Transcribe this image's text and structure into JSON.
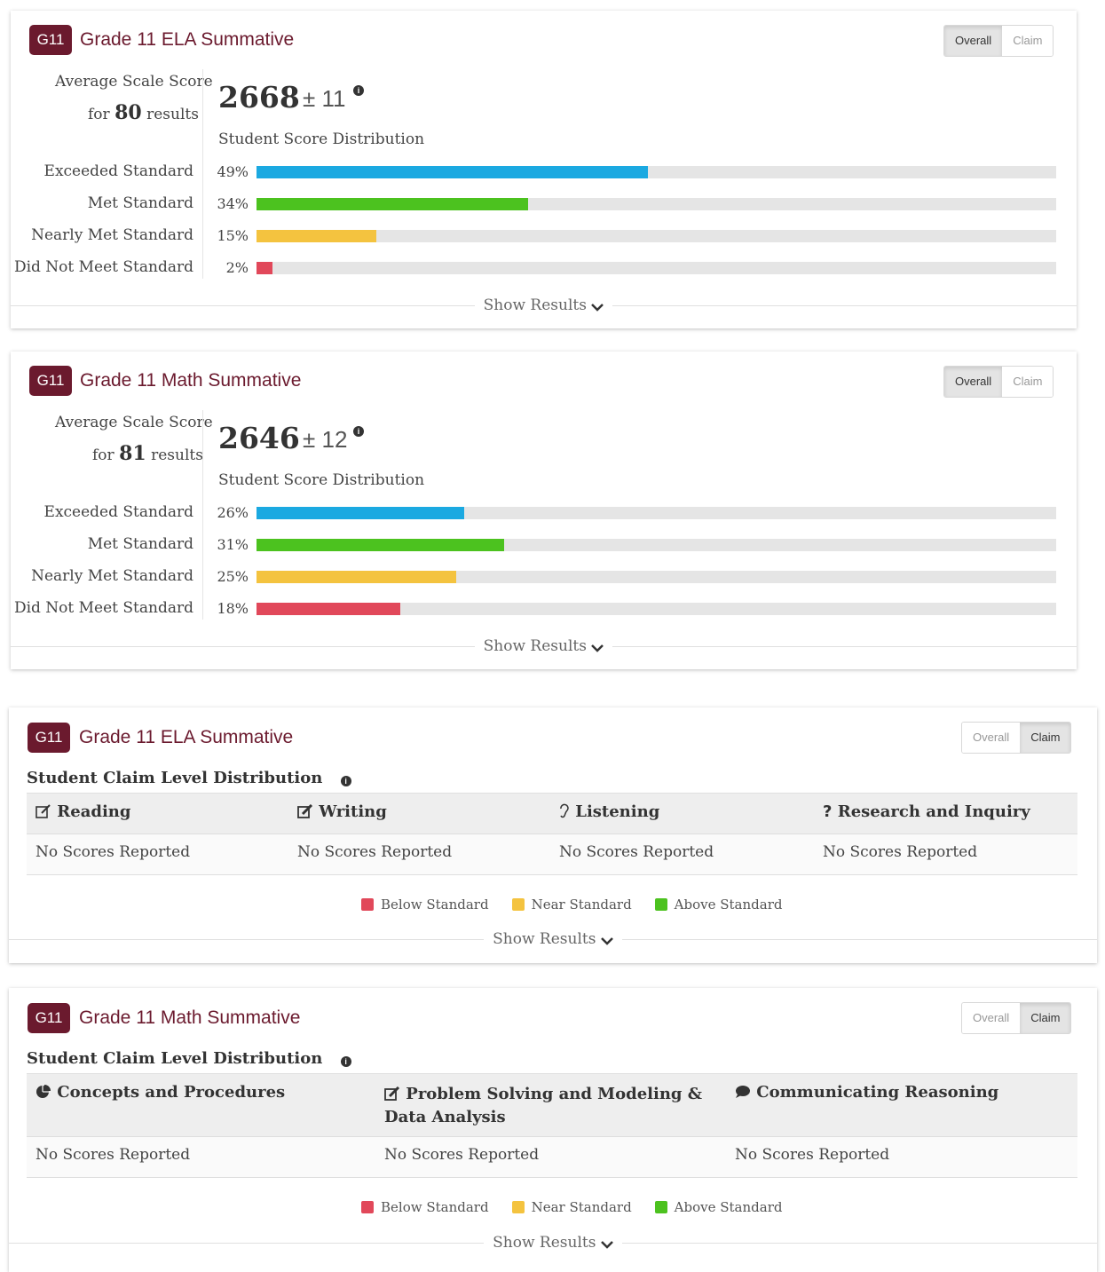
{
  "colors": {
    "badge": "#6b1a2e",
    "exceeded": "#1ba9e1",
    "met": "#4cc21f",
    "nearly": "#f4c33f",
    "not_met": "#e1485a",
    "track": "#e5e5e5"
  },
  "cards_overall": [
    {
      "badge": "G11",
      "title": "Grade 11 ELA Summative",
      "toggle": {
        "overall": "Overall",
        "claim": "Claim",
        "active": "overall"
      },
      "avg_label": "Average Scale Score",
      "for_text": "for",
      "count": "80",
      "results_text": "results",
      "score": "2668",
      "pm": "± 11",
      "dist_title": "Student Score Distribution",
      "rows": [
        {
          "label": "Exceeded Standard",
          "pct_text": "49%",
          "value": 49,
          "color_key": "exceeded"
        },
        {
          "label": "Met Standard",
          "pct_text": "34%",
          "value": 34,
          "color_key": "met"
        },
        {
          "label": "Nearly Met Standard",
          "pct_text": "15%",
          "value": 15,
          "color_key": "nearly"
        },
        {
          "label": "Did Not Meet Standard",
          "pct_text": "2%",
          "value": 2,
          "color_key": "not_met"
        }
      ],
      "show_results": "Show Results"
    },
    {
      "badge": "G11",
      "title": "Grade 11 Math Summative",
      "toggle": {
        "overall": "Overall",
        "claim": "Claim",
        "active": "overall"
      },
      "avg_label": "Average Scale Score",
      "for_text": "for",
      "count": "81",
      "results_text": "results",
      "score": "2646",
      "pm": "± 12",
      "dist_title": "Student Score Distribution",
      "rows": [
        {
          "label": "Exceeded Standard",
          "pct_text": "26%",
          "value": 26,
          "color_key": "exceeded"
        },
        {
          "label": "Met Standard",
          "pct_text": "31%",
          "value": 31,
          "color_key": "met"
        },
        {
          "label": "Nearly Met Standard",
          "pct_text": "25%",
          "value": 25,
          "color_key": "nearly"
        },
        {
          "label": "Did Not Meet Standard",
          "pct_text": "18%",
          "value": 18,
          "color_key": "not_met"
        }
      ],
      "show_results": "Show Results"
    }
  ],
  "cards_claim": [
    {
      "badge": "G11",
      "title": "Grade 11 ELA Summative",
      "toggle": {
        "overall": "Overall",
        "claim": "Claim",
        "active": "claim"
      },
      "heading": "Student Claim Level Distribution",
      "columns": [
        {
          "icon": "edit-icon",
          "label": "Reading",
          "value": "No Scores Reported"
        },
        {
          "icon": "pencil-square-icon",
          "label": "Writing",
          "value": "No Scores Reported"
        },
        {
          "icon": "ear-icon",
          "label": "Listening",
          "value": "No Scores Reported"
        },
        {
          "icon": "question-icon",
          "label": "Research and Inquiry",
          "value": "No Scores Reported"
        }
      ],
      "legend": [
        "Below Standard",
        "Near Standard",
        "Above Standard"
      ],
      "show_results": "Show Results"
    },
    {
      "badge": "G11",
      "title": "Grade 11 Math Summative",
      "toggle": {
        "overall": "Overall",
        "claim": "Claim",
        "active": "claim"
      },
      "heading": "Student Claim Level Distribution",
      "columns": [
        {
          "icon": "pie-chart-icon",
          "label": "Concepts and Procedures",
          "value": "No Scores Reported"
        },
        {
          "icon": "pencil-square-icon",
          "label": "Problem Solving and Modeling & Data Analysis",
          "value": "No Scores Reported"
        },
        {
          "icon": "comment-icon",
          "label": "Communicating Reasoning",
          "value": "No Scores Reported"
        }
      ],
      "legend": [
        "Below Standard",
        "Near Standard",
        "Above Standard"
      ],
      "show_results": "Show Results"
    }
  ]
}
